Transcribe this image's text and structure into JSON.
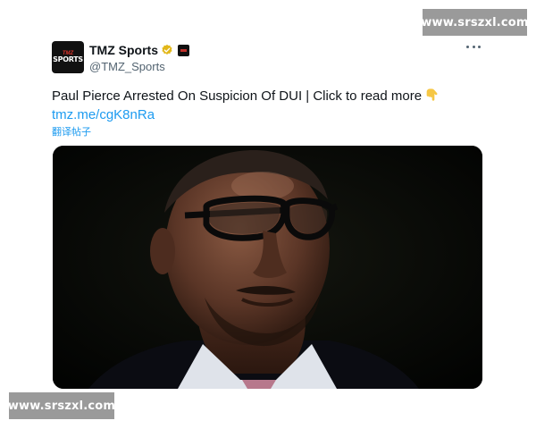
{
  "watermark": {
    "top": "www.srszxl.com",
    "bottom": "www.srszxl.com"
  },
  "tweet": {
    "avatar": {
      "line1": "TMZ",
      "line2": "SPORTS"
    },
    "display_name": "TMZ Sports",
    "handle": "@TMZ_Sports",
    "text": "Paul Pierce Arrested On Suspicion Of DUI  | Click to read more",
    "link": "tmz.me/cgK8nRa",
    "translate_label": "翻译帖子",
    "icons": {
      "verified": "gold-verified-badge",
      "affiliate": "affiliate-badge",
      "more": "more-dots",
      "pointing": "backhand-index-pointing-down-emoji"
    },
    "media": {
      "description_icon": "photo"
    }
  },
  "colors": {
    "link": "#1d9bf0",
    "handle": "#536471",
    "verified": "#e2b719"
  }
}
